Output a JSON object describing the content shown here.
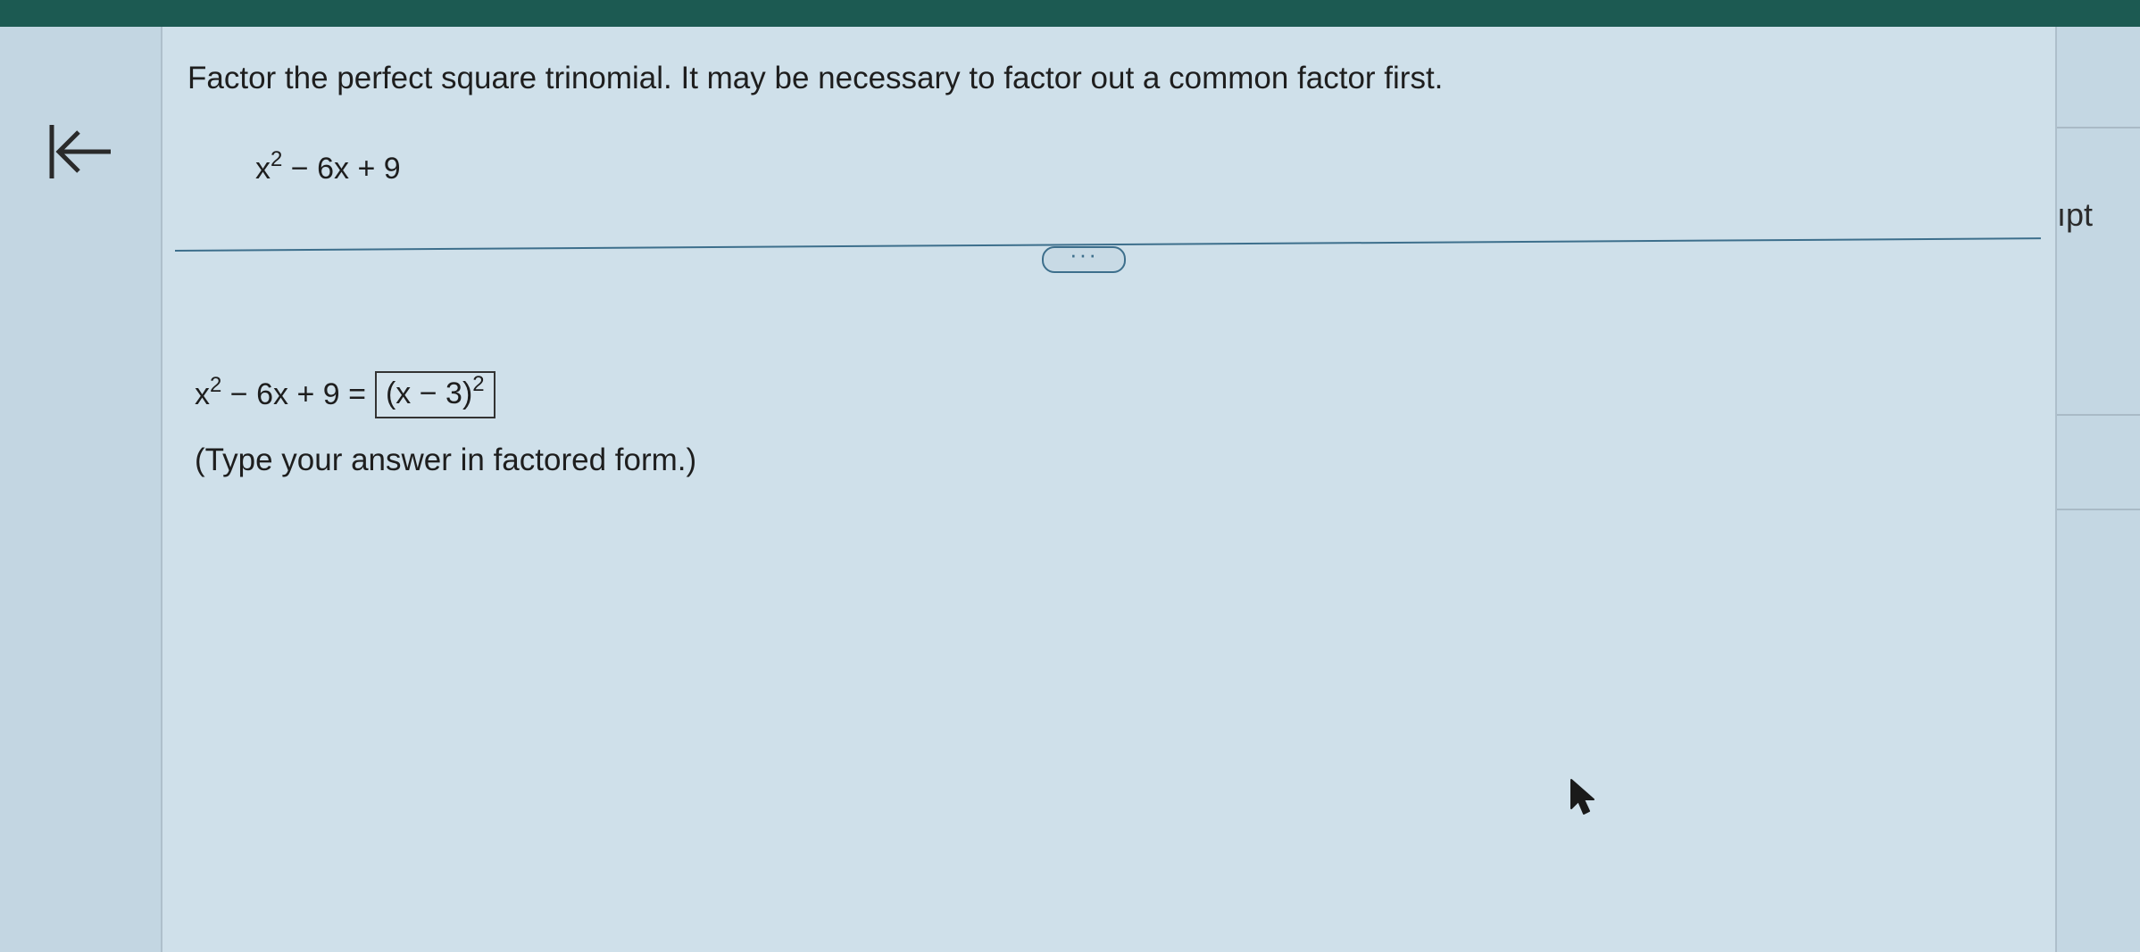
{
  "question": {
    "instructions": "Factor the perfect square trinomial. It may be necessary to factor out a common factor first.",
    "expression": {
      "base": "x",
      "exponent": "2",
      "rest": " − 6x + 9"
    }
  },
  "expand_button": {
    "label": "···"
  },
  "answer": {
    "lhs_base": "x",
    "lhs_exponent": "2",
    "lhs_rest": " − 6x + 9 =",
    "value_base": "(x − 3)",
    "value_exponent": "2"
  },
  "hint": "(Type your answer in factored form.)",
  "side_panel": {
    "label": "ıpt"
  },
  "icons": {
    "back": "back-to-start-icon",
    "cursor": "mouse-pointer-icon"
  },
  "colors": {
    "top_bar": "#1c5a52",
    "divider": "#3d6f8c",
    "background": "#cfe0ea"
  }
}
